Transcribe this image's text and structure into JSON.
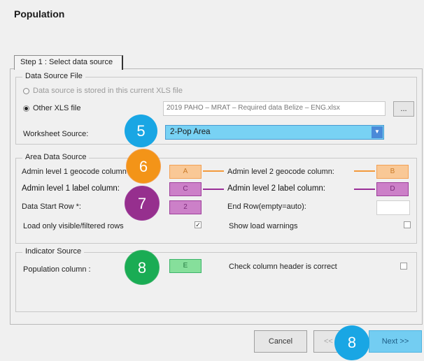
{
  "window": {
    "title": "Population"
  },
  "tab": {
    "label": "Step 1 : Select data source"
  },
  "data_source_file": {
    "title": "Data Source File",
    "radio_current": "Data source is stored in this current XLS file",
    "radio_other": "Other XLS file",
    "file_value": "2019 PAHO – MRAT – Required data Belize – ENG.xlsx",
    "browse_label": "...",
    "worksheet_label": "Worksheet Source:",
    "worksheet_value": "2-Pop Area",
    "selected_option": "other"
  },
  "area_data_source": {
    "title": "Area Data Source",
    "admin1_geocode_label": "Admin level 1 geocode column:",
    "admin1_geocode_value": "A",
    "admin2_geocode_label": "Admin level 2 geocode column:",
    "admin2_geocode_value": "B",
    "admin1_label_label": "Admin level 1 label column:",
    "admin1_label_value": "C",
    "admin2_label_label": "Admin level 2 label column:",
    "admin2_label_value": "D",
    "start_row_label": "Data Start Row *:",
    "start_row_value": "2",
    "end_row_label": "End Row(empty=auto):",
    "end_row_value": "",
    "load_visible_label": "Load only visible/filtered rows",
    "load_visible_checked": true,
    "show_warnings_label": "Show load warnings",
    "show_warnings_checked": false
  },
  "indicator_source": {
    "title": "Indicator Source",
    "population_label": "Population column :",
    "population_value": "E",
    "check_header_label": "Check column header is correct",
    "check_header_checked": false
  },
  "footer": {
    "cancel_label": "Cancel",
    "back_label": "<<",
    "next_label": "Next >>"
  },
  "callouts": {
    "worksheet": "5",
    "admin_geocode": "6",
    "admin_label": "7",
    "indicator": "8",
    "next": "8"
  },
  "colors": {
    "worksheet_select": "#78d2f4",
    "geocode_orange": "#f9c896",
    "label_purple": "#cc80c8",
    "indicator_green": "#86df9b",
    "callout_blue": "#19a6e4",
    "callout_orange": "#f39418",
    "callout_purple": "#962f8e",
    "callout_green": "#1aac54"
  }
}
